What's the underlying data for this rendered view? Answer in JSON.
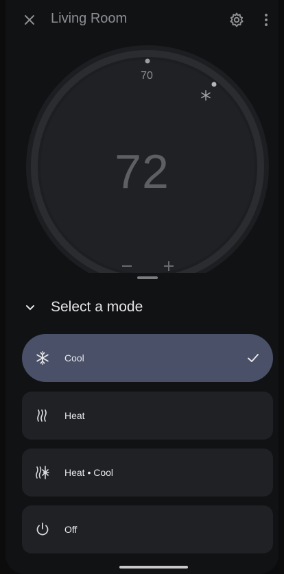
{
  "topbar": {
    "title": "Living Room",
    "close_icon": "close-icon",
    "settings_icon": "gear-icon",
    "more_icon": "more-vert-icon"
  },
  "thermostat": {
    "current_temp": "72",
    "setpoint": "70",
    "mode_indicator_icon": "snowflake-icon",
    "minus_icon": "minus-icon",
    "plus_icon": "plus-icon"
  },
  "mode_section": {
    "title": "Select a mode",
    "chevron_icon": "chevron-down-icon",
    "modes": [
      {
        "label": "Cool",
        "icon": "snowflake-icon",
        "selected": true
      },
      {
        "label": "Heat",
        "icon": "heat-waves-icon",
        "selected": false
      },
      {
        "label": "Heat • Cool",
        "icon": "heat-cool-icon",
        "selected": false
      },
      {
        "label": "Off",
        "icon": "power-icon",
        "selected": false
      }
    ]
  },
  "colors": {
    "background": "#111214",
    "active_mode": "#495068",
    "mode_card": "#202124",
    "text_primary": "#e6e6e8",
    "text_muted": "#8d8f93"
  }
}
